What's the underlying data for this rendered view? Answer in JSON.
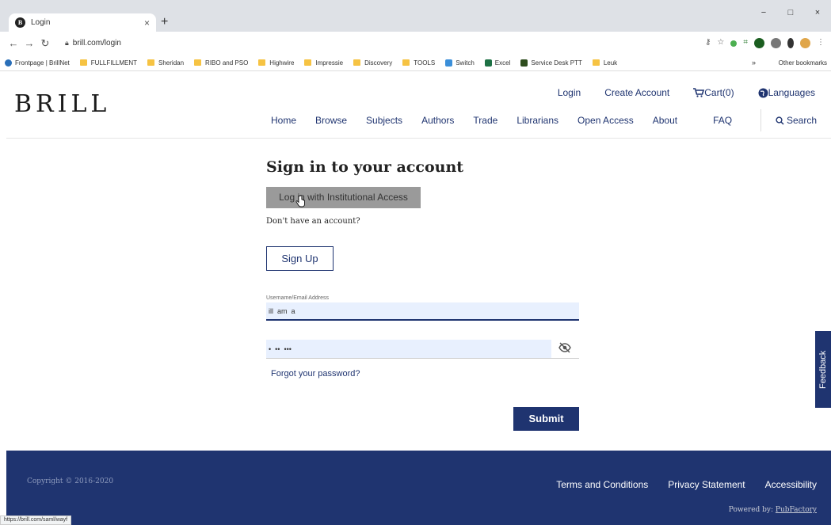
{
  "browser": {
    "tab_title": "Login",
    "tab_close": "×",
    "new_tab": "+",
    "url": "brill.com/login",
    "window_controls": [
      "−",
      "□",
      "×"
    ],
    "bookmarks": [
      "Frontpage | BrillNet",
      "FULLFILLMENT",
      "Sheridan",
      "RIBO and PSO",
      "Highwire",
      "Impressie",
      "Discovery",
      "TOOLS",
      "Switch",
      "Excel",
      "Service Desk PTT",
      "Leuk"
    ],
    "bookmarks_more": "»",
    "other_bookmarks": "Other bookmarks",
    "status_url": "https://brill.com/saml/wayf"
  },
  "header": {
    "logo": "BRILL",
    "top_links": {
      "login": "Login",
      "create_account": "Create Account",
      "cart": "Cart(0)",
      "languages": "Languages"
    },
    "main_nav": [
      "Home",
      "Browse",
      "Subjects",
      "Authors",
      "Trade",
      "Librarians",
      "Open Access",
      "About",
      "FAQ"
    ],
    "search": "Search"
  },
  "form": {
    "title": "Sign in to your account",
    "institutional_button": "Log in with Institutional Access",
    "no_account": "Don't have an account?",
    "signup_button": "Sign Up",
    "username_label": "Username/Email Address",
    "username_value": "ill  am  a",
    "password_value": "•  ••  •••",
    "forgot": "Forgot your password?",
    "submit": "Submit"
  },
  "feedback": "Feedback",
  "footer": {
    "copyright": "Copyright © 2016-2020",
    "links": [
      "Terms and Conditions",
      "Privacy Statement",
      "Accessibility"
    ],
    "powered_prefix": "Powered by: ",
    "powered_link": "PubFactory"
  },
  "colors": {
    "brand_navy": "#1f3470",
    "field_bg": "#e8f0fe",
    "disabled_button": "#9a9a9a"
  }
}
